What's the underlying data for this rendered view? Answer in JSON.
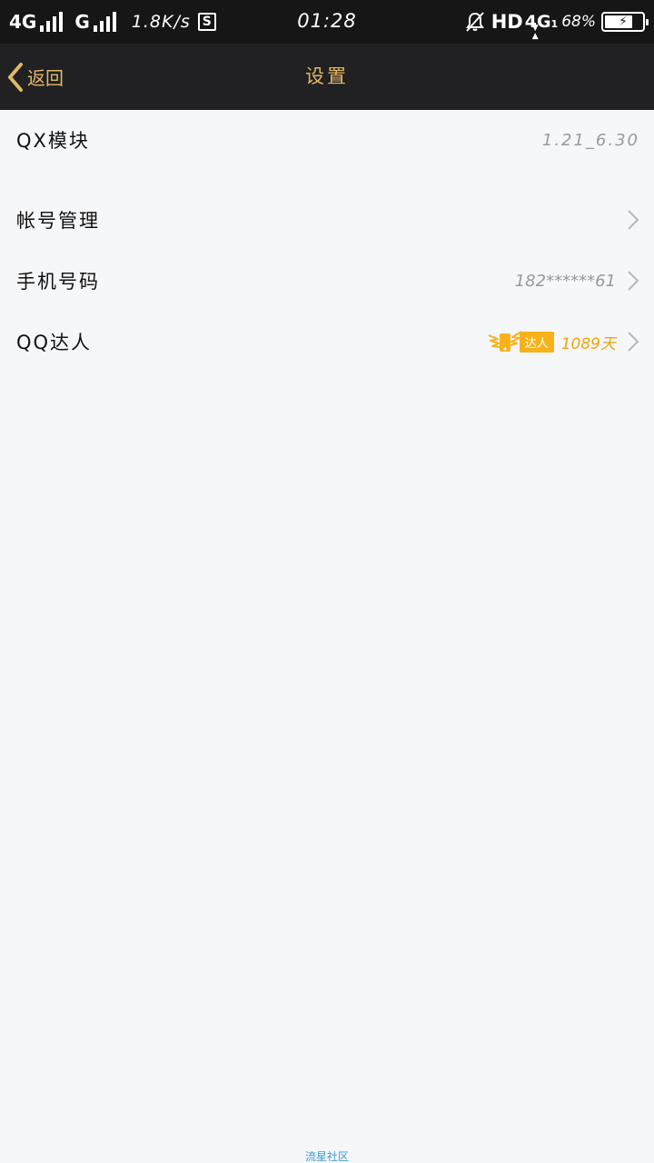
{
  "status_bar": {
    "network1": "4G",
    "network2": "G",
    "speed": "1.8K/s",
    "s_label": "S",
    "time": "01:28",
    "hd": "HD",
    "net4g": "4G",
    "net4g_sub": "1",
    "battery_pct": "68%",
    "battery_level": 0.68
  },
  "nav": {
    "back_label": "返回",
    "title": "设置"
  },
  "settings": {
    "qx_label": "QX模块",
    "qx_version": "1.21_6.30",
    "account_label": "帐号管理",
    "phone_label": "手机号码",
    "phone_value": "182******61",
    "talent_label": "QQ达人",
    "talent_badge": "达人",
    "talent_days": "1089天"
  },
  "footer": {
    "watermark": "流星社区"
  },
  "colors": {
    "accent_gold": "#e2b866",
    "badge_orange": "#f7b21a",
    "background": "#f6f7f9",
    "nav_bg": "#212123",
    "watermark_blue": "#3b9bd6"
  },
  "icons": [
    "back-chevron-icon",
    "chevron-right-icon",
    "mute-icon",
    "battery-icon",
    "talent-wing-icon",
    "s-app-icon"
  ]
}
